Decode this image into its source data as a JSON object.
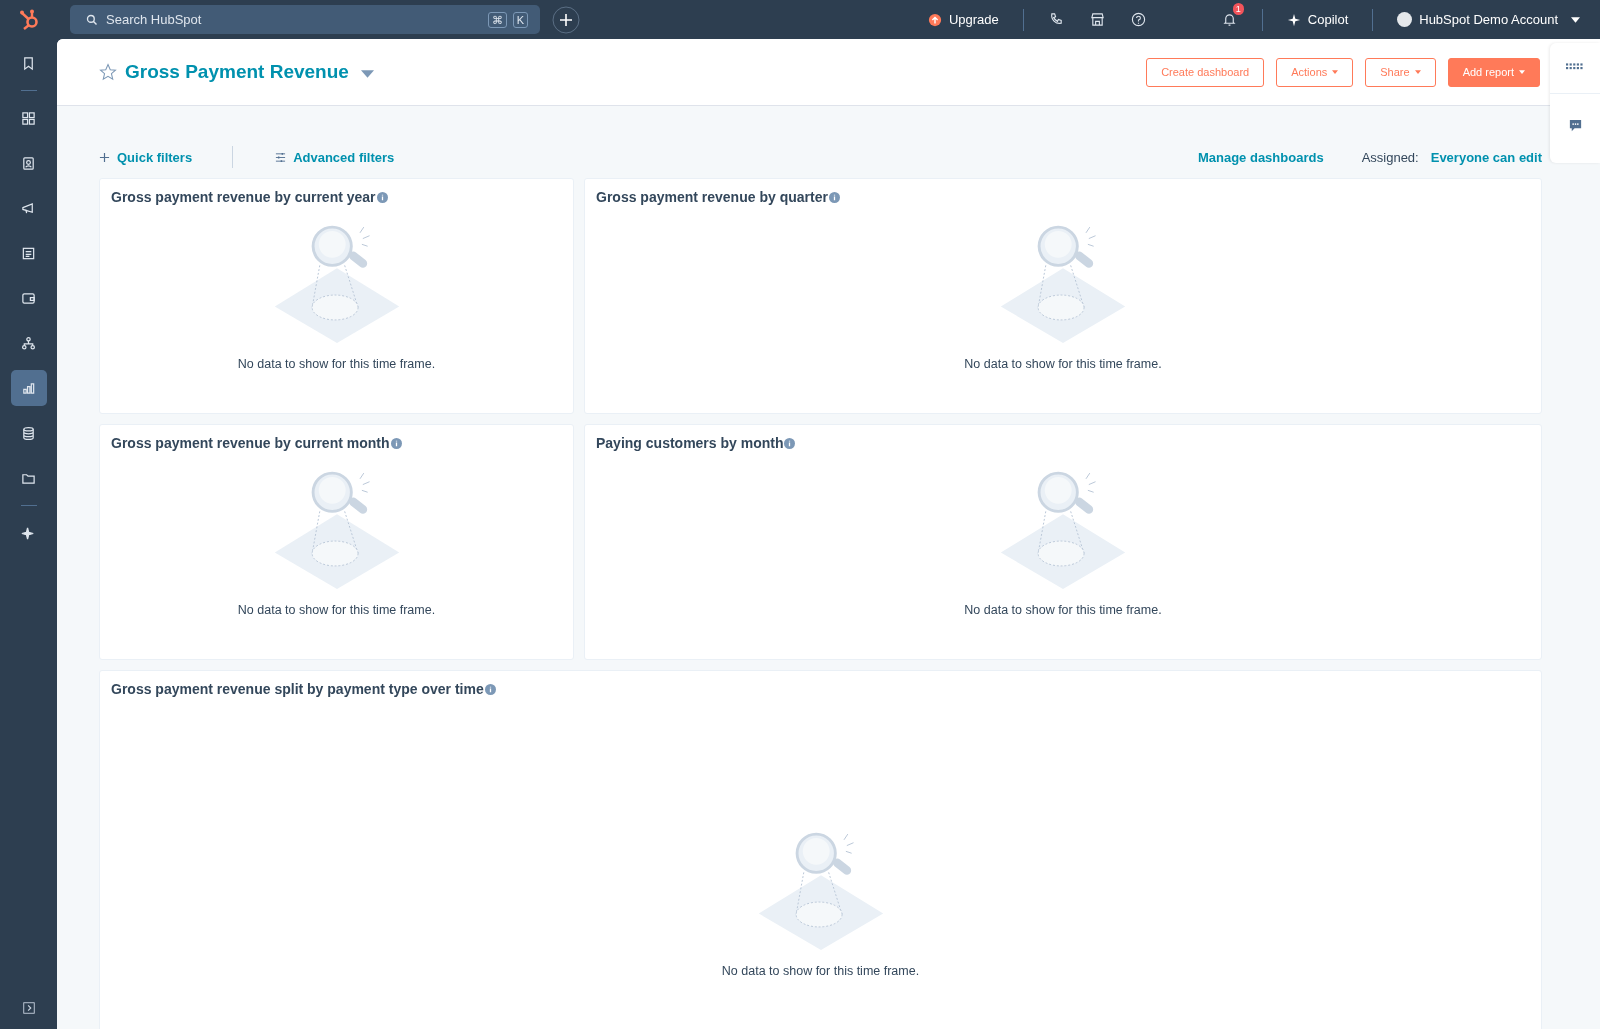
{
  "top_bar": {
    "search": {
      "placeholder": "Search HubSpot",
      "shortcut_keys": [
        "⌘",
        "K"
      ]
    },
    "upgrade": "Upgrade",
    "notification_count": "1",
    "copilot": "Copilot",
    "account": "HubSpot Demo Account"
  },
  "sidebar": {
    "items": [
      {
        "kind": "bookmark",
        "selected": false
      },
      {
        "kind": "divider"
      },
      {
        "kind": "grid",
        "selected": false
      },
      {
        "kind": "contacts",
        "selected": false
      },
      {
        "kind": "megaphone",
        "selected": false
      },
      {
        "kind": "form",
        "selected": false
      },
      {
        "kind": "wallet",
        "selected": false
      },
      {
        "kind": "hierarchy",
        "selected": false
      },
      {
        "kind": "chart",
        "selected": true
      },
      {
        "kind": "database",
        "selected": false
      },
      {
        "kind": "folder",
        "selected": false
      },
      {
        "kind": "divider"
      },
      {
        "kind": "sparkle",
        "selected": false
      }
    ]
  },
  "header": {
    "title": "Gross Payment Revenue",
    "buttons": [
      {
        "label": "Create dashboard",
        "kind": "outline",
        "dropdown": false
      },
      {
        "label": "Actions",
        "kind": "outline",
        "dropdown": true
      },
      {
        "label": "Share",
        "kind": "outline",
        "dropdown": true
      },
      {
        "label": "Add report",
        "kind": "primary",
        "dropdown": true
      }
    ]
  },
  "filters": {
    "quick": "Quick filters",
    "advanced": "Advanced filters",
    "manage": "Manage dashboards",
    "assigned_label": "Assigned:",
    "assigned_value": "Everyone can edit"
  },
  "reports": [
    {
      "title": "Gross payment revenue by current year",
      "message": "No data to show for this time frame.",
      "kind": "narrow"
    },
    {
      "title": "Gross payment revenue by quarter",
      "message": "No data to show for this time frame.",
      "kind": "wide"
    },
    {
      "title": "Gross payment revenue by current month",
      "message": "No data to show for this time frame.",
      "kind": "narrow"
    },
    {
      "title": "Paying customers by month",
      "message": "No data to show for this time frame.",
      "kind": "wide"
    },
    {
      "title": "Gross payment revenue split by payment type over time",
      "message": "No data to show for this time frame.",
      "kind": "full"
    }
  ]
}
